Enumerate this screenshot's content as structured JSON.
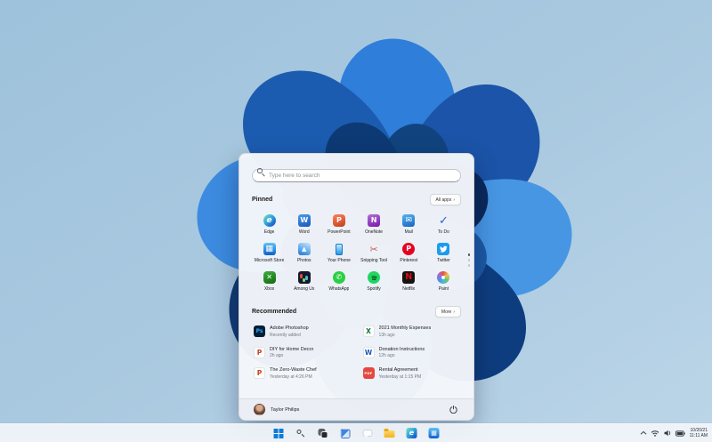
{
  "start_menu": {
    "search_placeholder": "Type here to search",
    "pinned": {
      "title": "Pinned",
      "all_apps_label": "All apps",
      "chevron": "›",
      "apps": [
        {
          "name": "Edge",
          "icon": "edge"
        },
        {
          "name": "Word",
          "icon": "word"
        },
        {
          "name": "PowerPoint",
          "icon": "powerpoint"
        },
        {
          "name": "OneNote",
          "icon": "onenote"
        },
        {
          "name": "Mail",
          "icon": "mail"
        },
        {
          "name": "To Do",
          "icon": "todo"
        },
        {
          "name": "Microsoft Store",
          "icon": "store"
        },
        {
          "name": "Photos",
          "icon": "photos"
        },
        {
          "name": "Your Phone",
          "icon": "phone"
        },
        {
          "name": "Snipping Tool",
          "icon": "snip"
        },
        {
          "name": "Pinterest",
          "icon": "pinterest"
        },
        {
          "name": "Twitter",
          "icon": "twitter"
        },
        {
          "name": "Xbox",
          "icon": "xbox"
        },
        {
          "name": "Among Us",
          "icon": "amongus"
        },
        {
          "name": "WhatsApp",
          "icon": "whatsapp"
        },
        {
          "name": "Spotify",
          "icon": "spotify"
        },
        {
          "name": "Netflix",
          "icon": "netflix"
        },
        {
          "name": "Paint",
          "icon": "paint"
        }
      ]
    },
    "recommended": {
      "title": "Recommended",
      "more_label": "More",
      "chevron": "›",
      "items": [
        {
          "title": "Adobe Photoshop",
          "subtitle": "Recently added",
          "icon": "photoshop"
        },
        {
          "title": "2021 Monthly Expenses",
          "subtitle": "13h ago",
          "icon": "excel"
        },
        {
          "title": "DIY for Home Decor",
          "subtitle": "2h ago",
          "icon": "ppt"
        },
        {
          "title": "Donation Instructions",
          "subtitle": "12h ago",
          "icon": "worddoc"
        },
        {
          "title": "The Zero-Waste Chef",
          "subtitle": "Yesterday at 4:26 PM",
          "icon": "ppt"
        },
        {
          "title": "Rental Agreement",
          "subtitle": "Yesterday at 1:15 PM",
          "icon": "pdf"
        }
      ]
    },
    "user": {
      "name": "Taylor Philips"
    }
  },
  "taskbar": {
    "buttons": [
      {
        "name": "start",
        "icon": "start"
      },
      {
        "name": "search",
        "icon": "search"
      },
      {
        "name": "task-view",
        "icon": "taskview"
      },
      {
        "name": "widgets",
        "icon": "widgets"
      },
      {
        "name": "chat",
        "icon": "chat"
      },
      {
        "name": "file-explorer",
        "icon": "explorer"
      },
      {
        "name": "edge",
        "icon": "edge-small"
      },
      {
        "name": "store",
        "icon": "store-small"
      }
    ],
    "clock": {
      "date": "10/20/21",
      "time": "11:11 AM"
    }
  },
  "colors": {
    "accent": "#0f7bd8",
    "menu_bg": "#f4f6fa",
    "taskbar_bg": "#f3f6fa"
  }
}
